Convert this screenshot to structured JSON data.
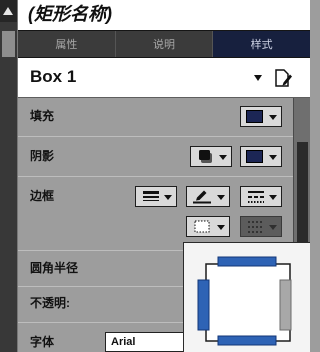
{
  "header": {
    "title": "(矩形名称)"
  },
  "tabs": [
    {
      "label": "属性",
      "selected": false
    },
    {
      "label": "说明",
      "selected": false
    },
    {
      "label": "样式",
      "selected": true
    }
  ],
  "widget_style": {
    "name": "Box 1",
    "dropdown_icon": "chevron-down-icon",
    "edit_icon": "edit-style-icon"
  },
  "properties": {
    "fill": {
      "label": "填充",
      "color": "#1c2655"
    },
    "shadow": {
      "label": "阴影",
      "style_icon": "shadow-icon",
      "color": "#1c2655"
    },
    "border": {
      "label": "边框",
      "weight_icon": "line-weight-icon",
      "color_icon": "pen-icon",
      "pattern_icon": "dash-pattern-icon",
      "visible_sides_icon": "border-sides-icon",
      "arrow_style_icon": "arrow-style-icon",
      "arrow_style_enabled": false
    },
    "corner_radius": {
      "label": "圆角半径"
    },
    "opacity": {
      "label": "不透明:"
    },
    "font": {
      "label": "字体",
      "value": "Arial"
    }
  },
  "border_sides_popup": {
    "top": true,
    "right": false,
    "bottom": true,
    "left": true,
    "selected_color": "#2e63b5",
    "selected_stroke": "#123676",
    "unselected_color": "#a8a8a8",
    "unselected_stroke": "#6b6b6b"
  },
  "colors": {
    "selected_tab": "#17203e"
  },
  "icons": {
    "scroll_up": "scroll-up-arrow-icon"
  }
}
